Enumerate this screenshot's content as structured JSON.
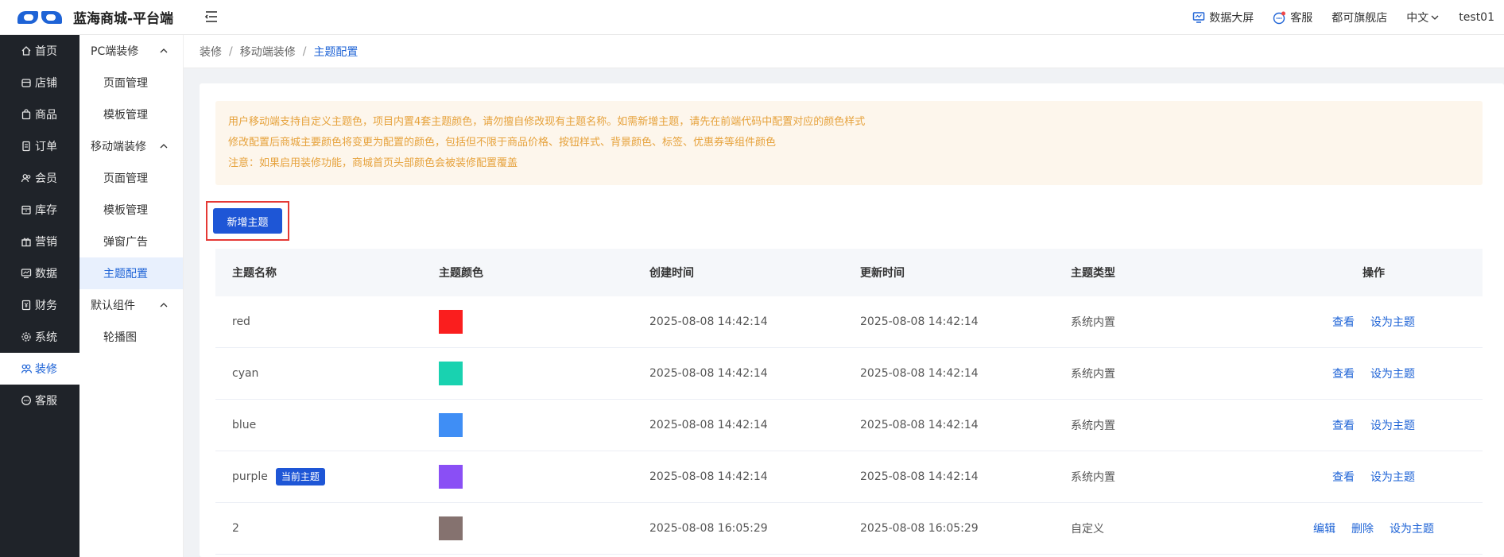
{
  "header": {
    "app_title": "蓝海商城-平台端",
    "big_screen": "数据大屏",
    "customer_service": "客服",
    "store": "都可旗舰店",
    "language": "中文",
    "user": "test01"
  },
  "nav": {
    "items": [
      {
        "label": "首页",
        "icon": "home-icon"
      },
      {
        "label": "店铺",
        "icon": "store-icon"
      },
      {
        "label": "商品",
        "icon": "bag-icon"
      },
      {
        "label": "订单",
        "icon": "order-icon"
      },
      {
        "label": "会员",
        "icon": "member-icon"
      },
      {
        "label": "库存",
        "icon": "inventory-icon"
      },
      {
        "label": "营销",
        "icon": "gift-icon"
      },
      {
        "label": "数据",
        "icon": "data-icon"
      },
      {
        "label": "财务",
        "icon": "finance-icon"
      },
      {
        "label": "系统",
        "icon": "gear-icon"
      },
      {
        "label": "装修",
        "icon": "decorate-icon",
        "active": true
      },
      {
        "label": "客服",
        "icon": "chat-icon"
      }
    ]
  },
  "submenu": {
    "pc_group": "PC端装修",
    "pc_items": [
      "页面管理",
      "模板管理"
    ],
    "mobile_group": "移动端装修",
    "mobile_items": [
      "页面管理",
      "模板管理",
      "弹窗广告",
      "主题配置"
    ],
    "default_group": "默认组件",
    "default_items": [
      "轮播图"
    ]
  },
  "breadcrumb": {
    "level1": "装修",
    "level2": "移动端装修",
    "current": "主题配置"
  },
  "notice": {
    "line1": "用户移动端支持自定义主题色，项目内置4套主题颜色，请勿擅自修改现有主题名称。如需新增主题，请先在前端代码中配置对应的颜色样式",
    "line2": "修改配置后商城主要颜色将变更为配置的颜色，包括但不限于商品价格、按钮样式、背景颜色、标签、优惠券等组件颜色",
    "line3": "注意：如果启用装修功能，商城首页头部颜色会被装修配置覆盖"
  },
  "add_button": "新增主题",
  "table": {
    "headers": {
      "name": "主题名称",
      "color": "主题颜色",
      "created": "创建时间",
      "updated": "更新时间",
      "type": "主题类型",
      "actions": "操作"
    },
    "current_badge": "当前主题",
    "op_view": "查看",
    "op_set": "设为主题",
    "op_edit": "编辑",
    "op_delete": "删除",
    "rows": [
      {
        "name": "red",
        "color": "#fa1e1e",
        "created": "2025-08-08 14:42:14",
        "updated": "2025-08-08 14:42:14",
        "type": "系统内置"
      },
      {
        "name": "cyan",
        "color": "#19d2b0",
        "created": "2025-08-08 14:42:14",
        "updated": "2025-08-08 14:42:14",
        "type": "系统内置"
      },
      {
        "name": "blue",
        "color": "#3f8ef5",
        "created": "2025-08-08 14:42:14",
        "updated": "2025-08-08 14:42:14",
        "type": "系统内置"
      },
      {
        "name": "purple",
        "color": "#8a4ff5",
        "created": "2025-08-08 14:42:14",
        "updated": "2025-08-08 14:42:14",
        "type": "系统内置"
      },
      {
        "name": "2",
        "color": "#85726f",
        "created": "2025-08-08 16:05:29",
        "updated": "2025-08-08 16:05:29",
        "type": "自定义"
      }
    ]
  }
}
